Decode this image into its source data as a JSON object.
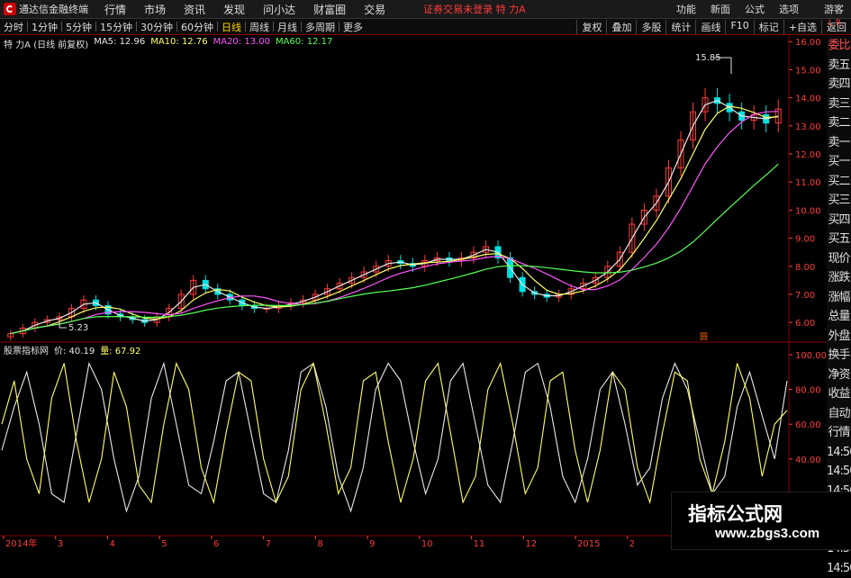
{
  "menubar": {
    "app_title": "通达信金融终端",
    "items": [
      "行情",
      "市场",
      "资讯",
      "发现",
      "问小达",
      "财富圈",
      "交易"
    ],
    "notice": "证券交易未登录  特 力A",
    "right_items": [
      "功能",
      "新面",
      "公式",
      "选项",
      "游客"
    ]
  },
  "toolbar": {
    "timeframes": [
      "分时",
      "1分钟",
      "5分钟",
      "15分钟",
      "30分钟",
      "60分钟",
      "日线",
      "周线",
      "月线",
      "多周期",
      "更多"
    ],
    "active": "日线",
    "buttons": [
      "复权",
      "叠加",
      "多股",
      "统计",
      "画线",
      "F10",
      "标记",
      "+自选",
      "返回"
    ]
  },
  "legend": {
    "stock": "特 力A (日线 前复权)",
    "ma5": "MA5: 12.96",
    "ma10": "MA10: 12.76",
    "ma20": "MA20: 13.00",
    "ma60": "MA60: 12.17"
  },
  "indicator_legend": {
    "name": "股票指标网",
    "v1": "价: 40.19",
    "v2": "量: 67.92"
  },
  "side_labels": [
    "委比",
    "卖五",
    "卖四",
    "卖三",
    "卖二",
    "卖一",
    "买一",
    "买二",
    "买三",
    "买四",
    "买五",
    "现价",
    "涨跌",
    "涨幅",
    "总量",
    "外盘",
    "换手",
    "净资",
    "收益",
    "自动",
    "行情",
    "14:50",
    "14:50",
    "14:50",
    "14:50",
    "14:50",
    "14:50",
    "14:50"
  ],
  "top_right_mark": "L R",
  "annotations": {
    "high": "15.85",
    "low": "5.23",
    "badge": "圆"
  },
  "watermark": {
    "line1": "指标公式网",
    "line2": "www.zbgs3.com"
  },
  "colors": {
    "up": "#ff3b3b",
    "down": "#00e0e0",
    "ma5": "#e8e8e8",
    "ma10": "#ffff66",
    "ma20": "#ff55ff",
    "ma60": "#55ff55"
  },
  "chart_data": [
    {
      "type": "candlestick",
      "title": "特 力A (日线 前复权)",
      "ylim": [
        5.3,
        16.2
      ],
      "y_ticks": [
        6.0,
        7.0,
        8.0,
        9.0,
        10.0,
        11.0,
        12.0,
        13.0,
        14.0,
        15.0,
        16.0
      ],
      "x_ticks": [
        "2014年",
        "3",
        "4",
        "5",
        "6",
        "7",
        "8",
        "9",
        "10",
        "11",
        "12",
        "2015",
        "2",
        "3",
        "4"
      ],
      "close_approx": [
        5.6,
        5.8,
        6.0,
        6.1,
        6.2,
        6.5,
        6.8,
        6.6,
        6.3,
        6.2,
        6.1,
        6.0,
        6.2,
        6.5,
        7.0,
        7.5,
        7.2,
        7.0,
        6.8,
        6.6,
        6.5,
        6.5,
        6.6,
        6.7,
        6.8,
        7.0,
        7.2,
        7.4,
        7.6,
        7.8,
        8.0,
        8.2,
        8.1,
        8.0,
        8.2,
        8.3,
        8.2,
        8.3,
        8.5,
        8.7,
        8.3,
        7.6,
        7.1,
        7.0,
        6.9,
        7.0,
        7.2,
        7.4,
        7.6,
        8.0,
        8.5,
        9.5,
        10.0,
        10.5,
        11.5,
        12.5,
        13.5,
        14.0,
        13.8,
        13.5,
        13.2,
        13.4,
        13.1,
        13.6
      ],
      "ma5": 12.96,
      "ma10": 12.76,
      "ma20": 13.0,
      "ma60": 12.17
    },
    {
      "type": "line",
      "title": "股票指标网",
      "ylim": [
        0,
        100
      ],
      "y_ticks": [
        40.0,
        60.0,
        80.0,
        100.0
      ],
      "series": [
        {
          "name": "价",
          "last": 40.19,
          "values": [
            45,
            70,
            90,
            60,
            20,
            15,
            55,
            95,
            80,
            40,
            10,
            30,
            75,
            95,
            60,
            25,
            20,
            50,
            85,
            90,
            55,
            20,
            15,
            45,
            90,
            95,
            70,
            30,
            10,
            35,
            80,
            95,
            85,
            50,
            20,
            40,
            85,
            95,
            60,
            25,
            15,
            50,
            90,
            95,
            70,
            30,
            15,
            40,
            80,
            90,
            60,
            25,
            35,
            75,
            95,
            80,
            50,
            20,
            30,
            70,
            90,
            65,
            40,
            85
          ]
        },
        {
          "name": "量",
          "last": 67.92,
          "values": [
            60,
            85,
            40,
            20,
            75,
            95,
            50,
            15,
            40,
            90,
            70,
            25,
            15,
            60,
            95,
            80,
            35,
            15,
            55,
            90,
            85,
            40,
            15,
            30,
            80,
            95,
            60,
            20,
            35,
            85,
            90,
            50,
            15,
            40,
            85,
            95,
            55,
            15,
            30,
            80,
            95,
            60,
            20,
            35,
            85,
            90,
            45,
            15,
            45,
            90,
            80,
            35,
            15,
            55,
            90,
            85,
            40,
            20,
            50,
            95,
            75,
            30,
            60,
            68
          ]
        }
      ]
    }
  ]
}
